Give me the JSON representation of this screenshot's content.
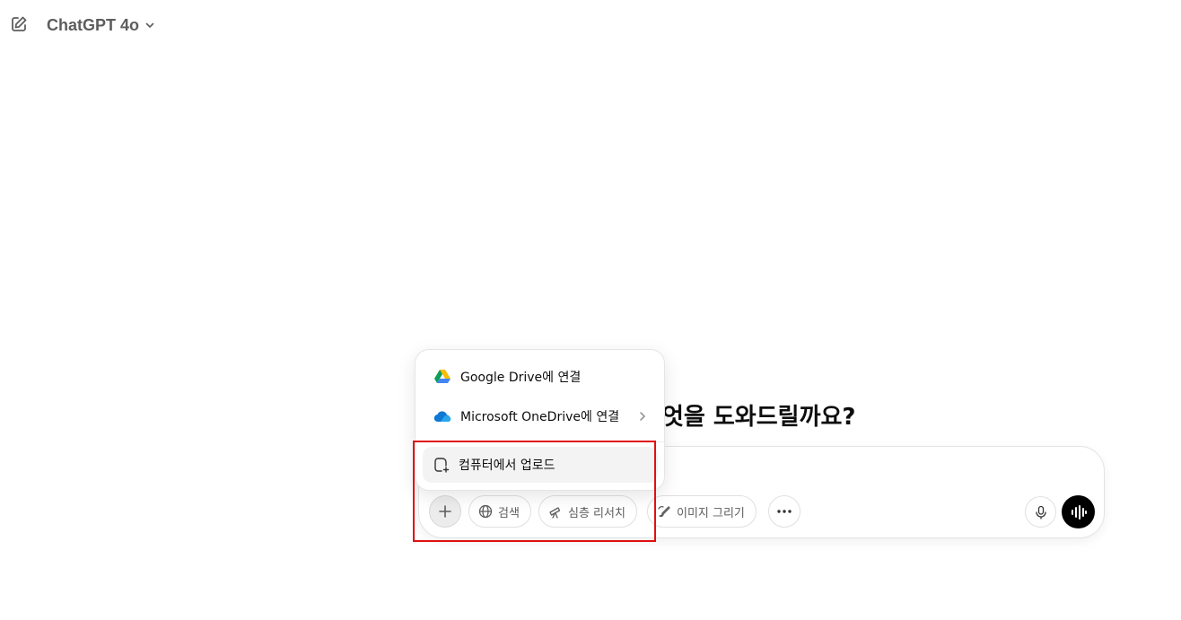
{
  "header": {
    "model_name": "ChatGPT 4o",
    "new_chat_icon": "edit-icon",
    "chevron_icon": "chevron-down-icon"
  },
  "main": {
    "headline": "엇을 도와드릴까요?"
  },
  "composer": {
    "tools": [
      {
        "label": "검색",
        "icon": "globe-icon"
      },
      {
        "label": "심층 리서치",
        "icon": "telescope-icon"
      },
      {
        "label": "이미지 그리기",
        "icon": "paint-icon"
      }
    ],
    "more_icon": "more-icon",
    "mic_icon": "mic-icon",
    "voice_icon": "voice-mode-icon"
  },
  "attach_menu": {
    "items": [
      {
        "label": "Google Drive에 연결",
        "icon": "google-drive-icon"
      },
      {
        "label": "Microsoft OneDrive에 연결",
        "icon": "onedrive-icon",
        "has_submenu": true
      },
      {
        "label": "컴퓨터에서 업로드",
        "icon": "upload-file-icon"
      }
    ]
  },
  "colors": {
    "highlight": "#e01010",
    "text_primary": "#0d0d0d",
    "text_secondary": "#5d5d5d"
  }
}
